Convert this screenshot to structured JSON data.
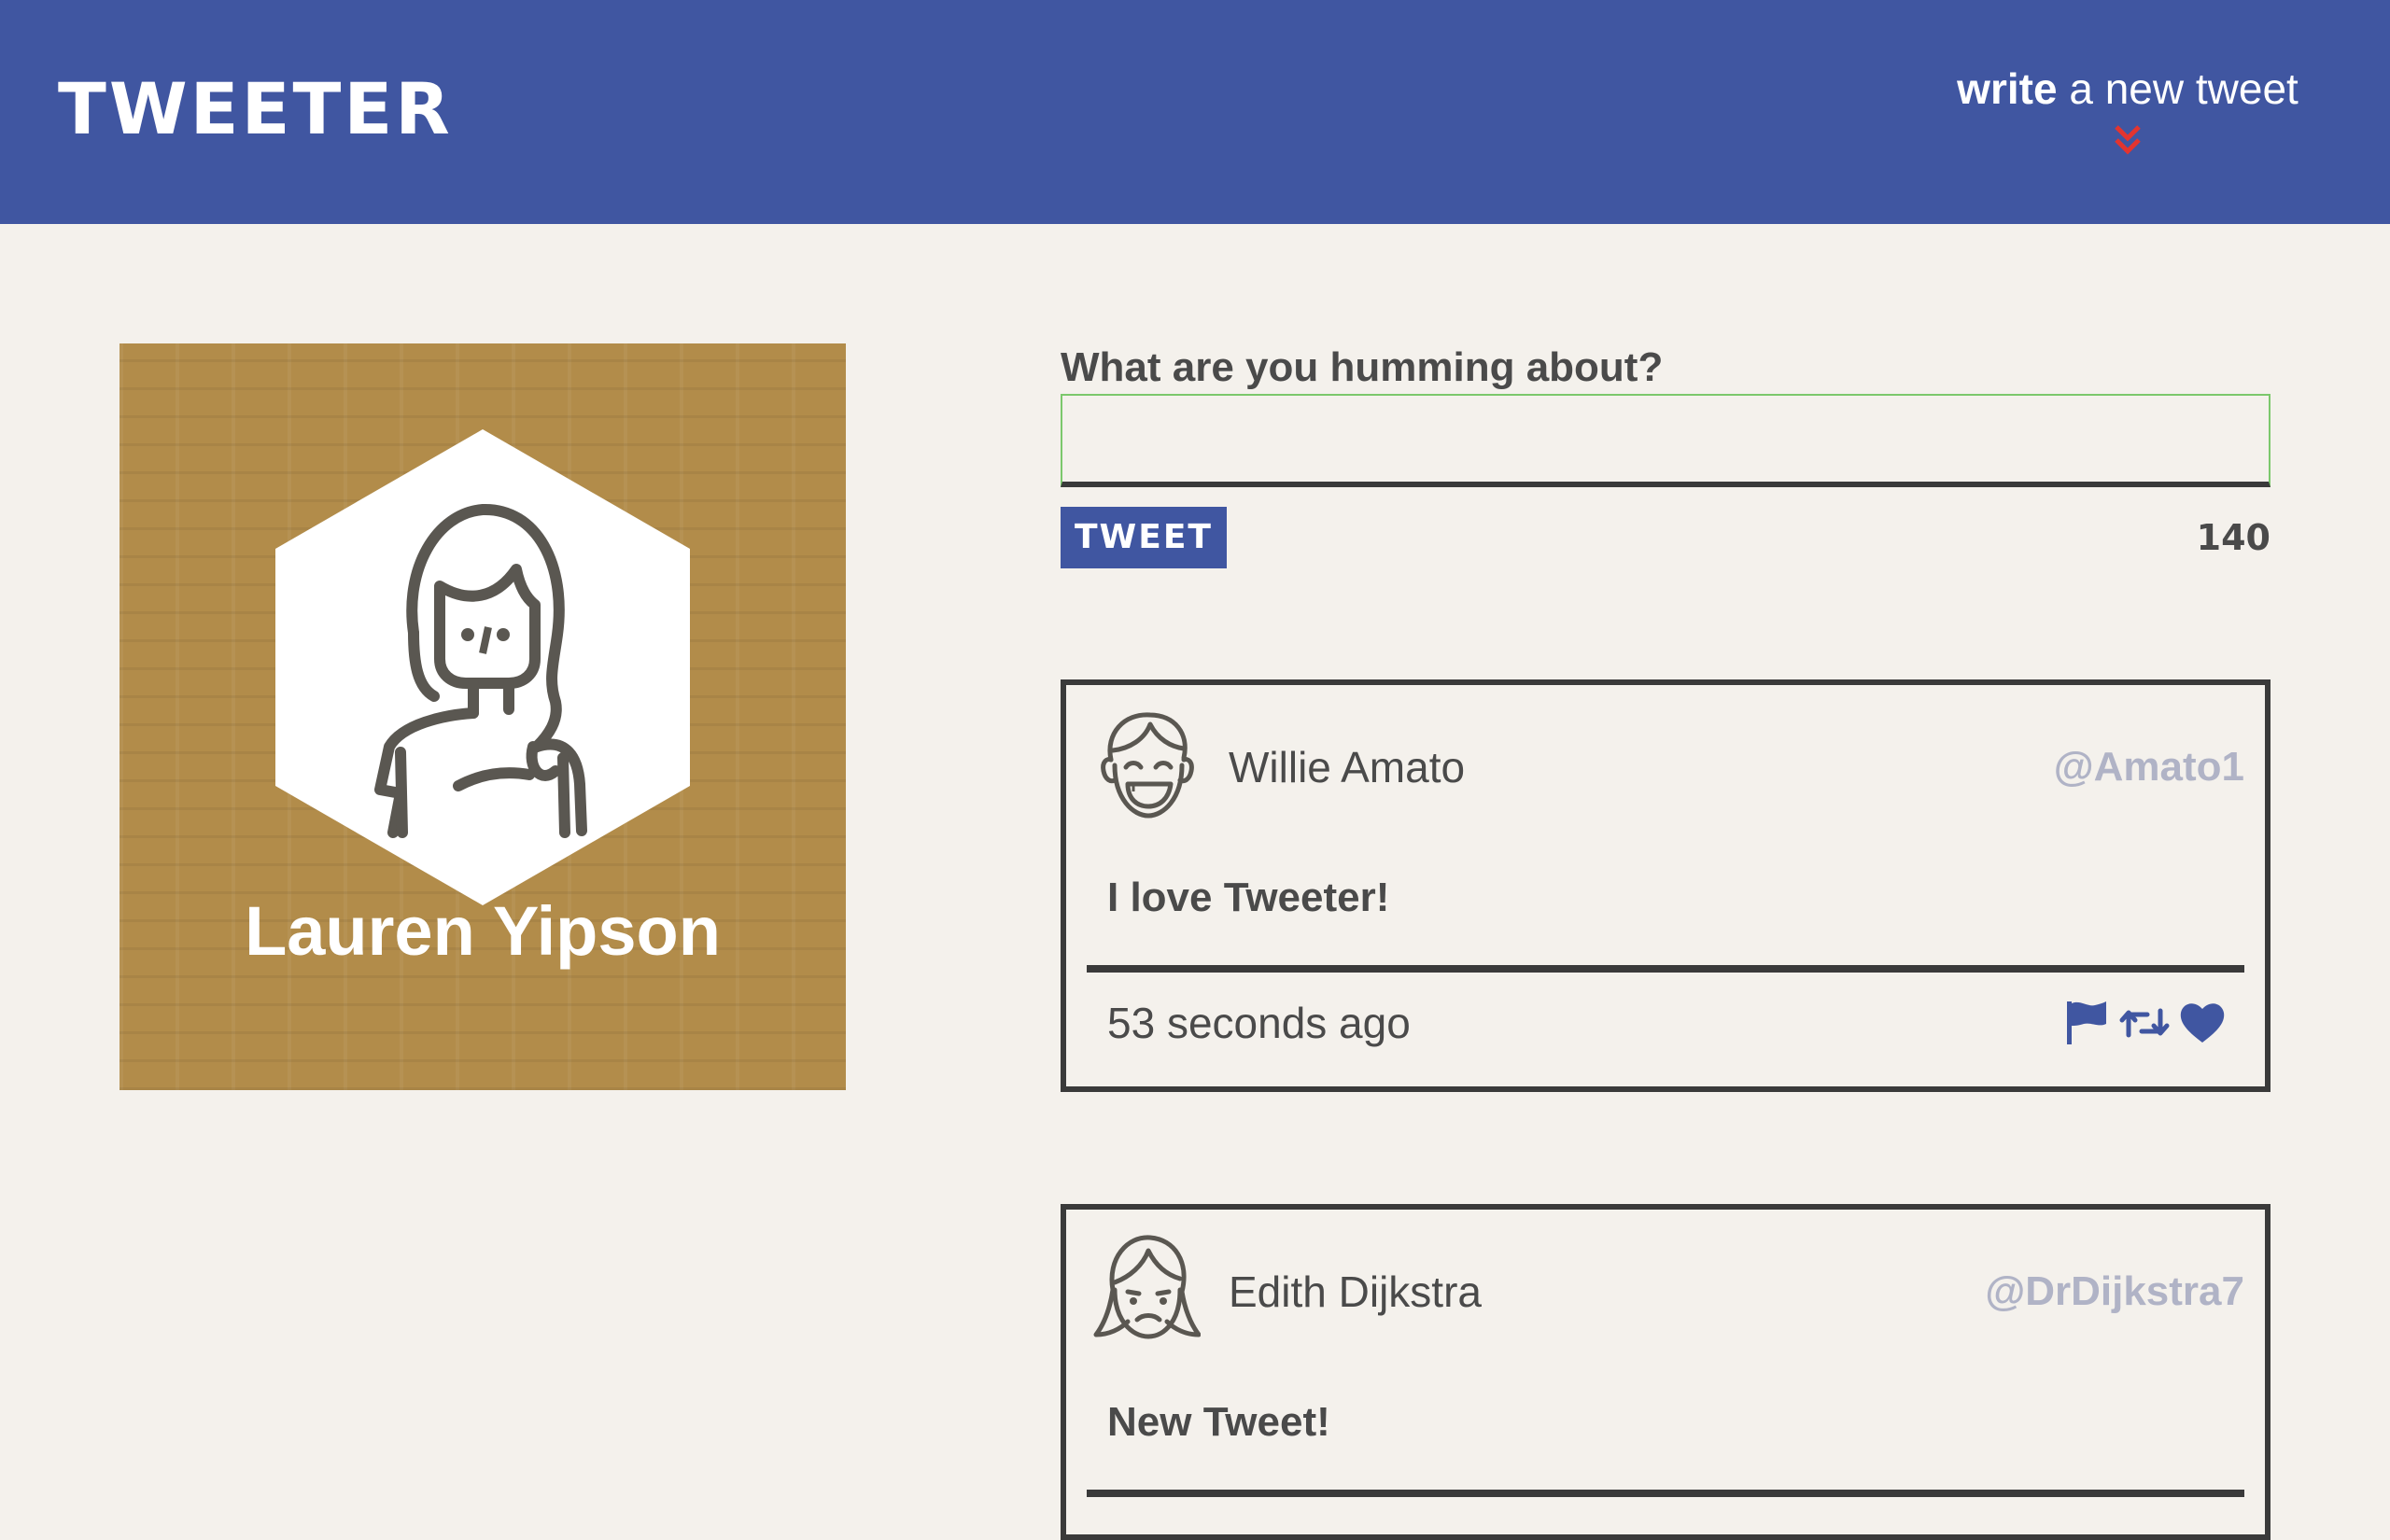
{
  "nav": {
    "brand": "TWEETER",
    "compose_toggle": {
      "strong": "write",
      "light": " a new tweet"
    }
  },
  "profile": {
    "name": "Lauren Yipson",
    "avatar_icon": "woman-avatar-icon"
  },
  "compose": {
    "label": "What are you humming about?",
    "input_value": "",
    "button_label": "TWEET",
    "counter": "140"
  },
  "tweets": [
    {
      "name": "Willie Amato",
      "handle": "@Amato1",
      "text": "I love Tweeter!",
      "time": "53 seconds ago",
      "avatar_icon": "laughing-man-icon"
    },
    {
      "name": "Edith Dijkstra",
      "handle": "@DrDijkstra7",
      "text": "New Tweet!",
      "avatar_icon": "sad-woman-icon"
    }
  ],
  "actions": [
    "flag-icon",
    "retweet-icon",
    "heart-icon"
  ],
  "colors": {
    "nav": "#4056a1",
    "page_bg": "#f4f1ec",
    "profile_bg": "#b28c4a",
    "text": "#4a4a4a",
    "handle": "#b0b3c6",
    "chevron": "#e3342f",
    "input_focus": "#7bc86c"
  }
}
